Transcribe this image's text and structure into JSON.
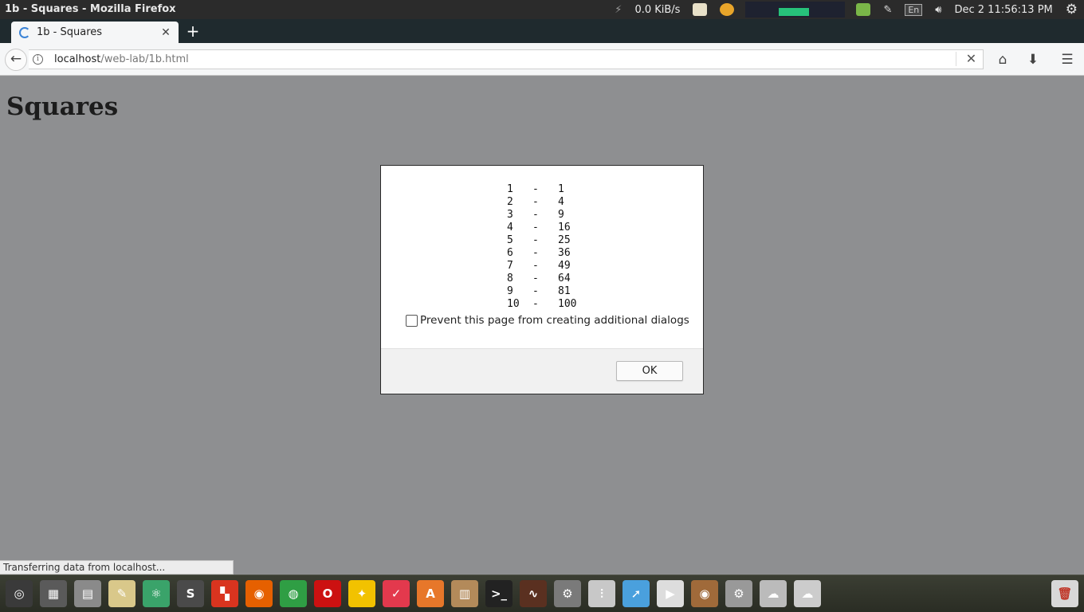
{
  "window": {
    "title": "1b - Squares - Mozilla Firefox"
  },
  "top_panel": {
    "net_speed": "0.0 KiB/s",
    "language": "En",
    "datetime": "Dec  2 11:56:13 PM"
  },
  "tabs": [
    {
      "label": "1b - Squares",
      "close": "✕"
    }
  ],
  "new_tab": "+",
  "navbar": {
    "back": "←",
    "url_host": "localhost",
    "url_path": "/web-lab/1b.html",
    "stop": "✕",
    "home": "⌂",
    "download": "⬇",
    "menu": "☰"
  },
  "page": {
    "heading": "Squares"
  },
  "dialog": {
    "rows": [
      {
        "n": "1",
        "sep": "-",
        "sq": "1"
      },
      {
        "n": "2",
        "sep": "-",
        "sq": "4"
      },
      {
        "n": "3",
        "sep": "-",
        "sq": "9"
      },
      {
        "n": "4",
        "sep": "-",
        "sq": "16"
      },
      {
        "n": "5",
        "sep": "-",
        "sq": "25"
      },
      {
        "n": "6",
        "sep": "-",
        "sq": "36"
      },
      {
        "n": "7",
        "sep": "-",
        "sq": "49"
      },
      {
        "n": "8",
        "sep": "-",
        "sq": "64"
      },
      {
        "n": "9",
        "sep": "-",
        "sq": "81"
      },
      {
        "n": "10",
        "sep": "-",
        "sq": "100"
      }
    ],
    "prevent_label": "Prevent this page from creating additional dialogs",
    "prevent_checked": false,
    "ok_label": "OK"
  },
  "status": {
    "text": "Transferring data from localhost..."
  },
  "launcher": {
    "apps": [
      {
        "name": "ubuntu-dash-icon",
        "color": "#3a3a3a",
        "glyph": "◎"
      },
      {
        "name": "workspace-switcher-icon",
        "color": "#5a5a5a",
        "glyph": "▦"
      },
      {
        "name": "files-icon",
        "color": "#8a8a8a",
        "glyph": "▤"
      },
      {
        "name": "text-editor-icon",
        "color": "#d9c88a",
        "glyph": "✎"
      },
      {
        "name": "atom-icon",
        "color": "#3aa36a",
        "glyph": "⚛"
      },
      {
        "name": "sublime-text-icon",
        "color": "#4a4a4a",
        "glyph": "S"
      },
      {
        "name": "ms-office-icon",
        "color": "#d9341f",
        "glyph": "▚"
      },
      {
        "name": "firefox-icon",
        "color": "#e66000",
        "glyph": "◉"
      },
      {
        "name": "chrome-icon",
        "color": "#2f9e44",
        "glyph": "◍"
      },
      {
        "name": "opera-icon",
        "color": "#cc1111",
        "glyph": "O"
      },
      {
        "name": "ideas-bulb-icon",
        "color": "#f2c200",
        "glyph": "✦"
      },
      {
        "name": "pocket-icon",
        "color": "#e3394d",
        "glyph": "✓"
      },
      {
        "name": "software-center-icon",
        "color": "#e7772a",
        "glyph": "A"
      },
      {
        "name": "archive-manager-icon",
        "color": "#b38a5a",
        "glyph": "▥"
      },
      {
        "name": "terminal-icon",
        "color": "#222222",
        "glyph": ">_"
      },
      {
        "name": "system-monitor-icon",
        "color": "#5a3020",
        "glyph": "∿"
      },
      {
        "name": "system-tools-icon",
        "color": "#7a7a7a",
        "glyph": "⚙"
      },
      {
        "name": "mixer-icon",
        "color": "#c8c8c8",
        "glyph": "⫶"
      },
      {
        "name": "pointer-app-icon",
        "color": "#4aa0dd",
        "glyph": "➚"
      },
      {
        "name": "video-player-icon",
        "color": "#dddddd",
        "glyph": "▶"
      },
      {
        "name": "speaker-icon",
        "color": "#a06a3a",
        "glyph": "◉"
      },
      {
        "name": "settings-icon",
        "color": "#999999",
        "glyph": "⚙"
      },
      {
        "name": "chat-icon",
        "color": "#bbbbbb",
        "glyph": "☁"
      },
      {
        "name": "messaging-icon",
        "color": "#cccccc",
        "glyph": "☁"
      }
    ],
    "trash": {
      "name": "trash-icon",
      "color": "#d8d8d8",
      "glyph": "🗑"
    }
  }
}
